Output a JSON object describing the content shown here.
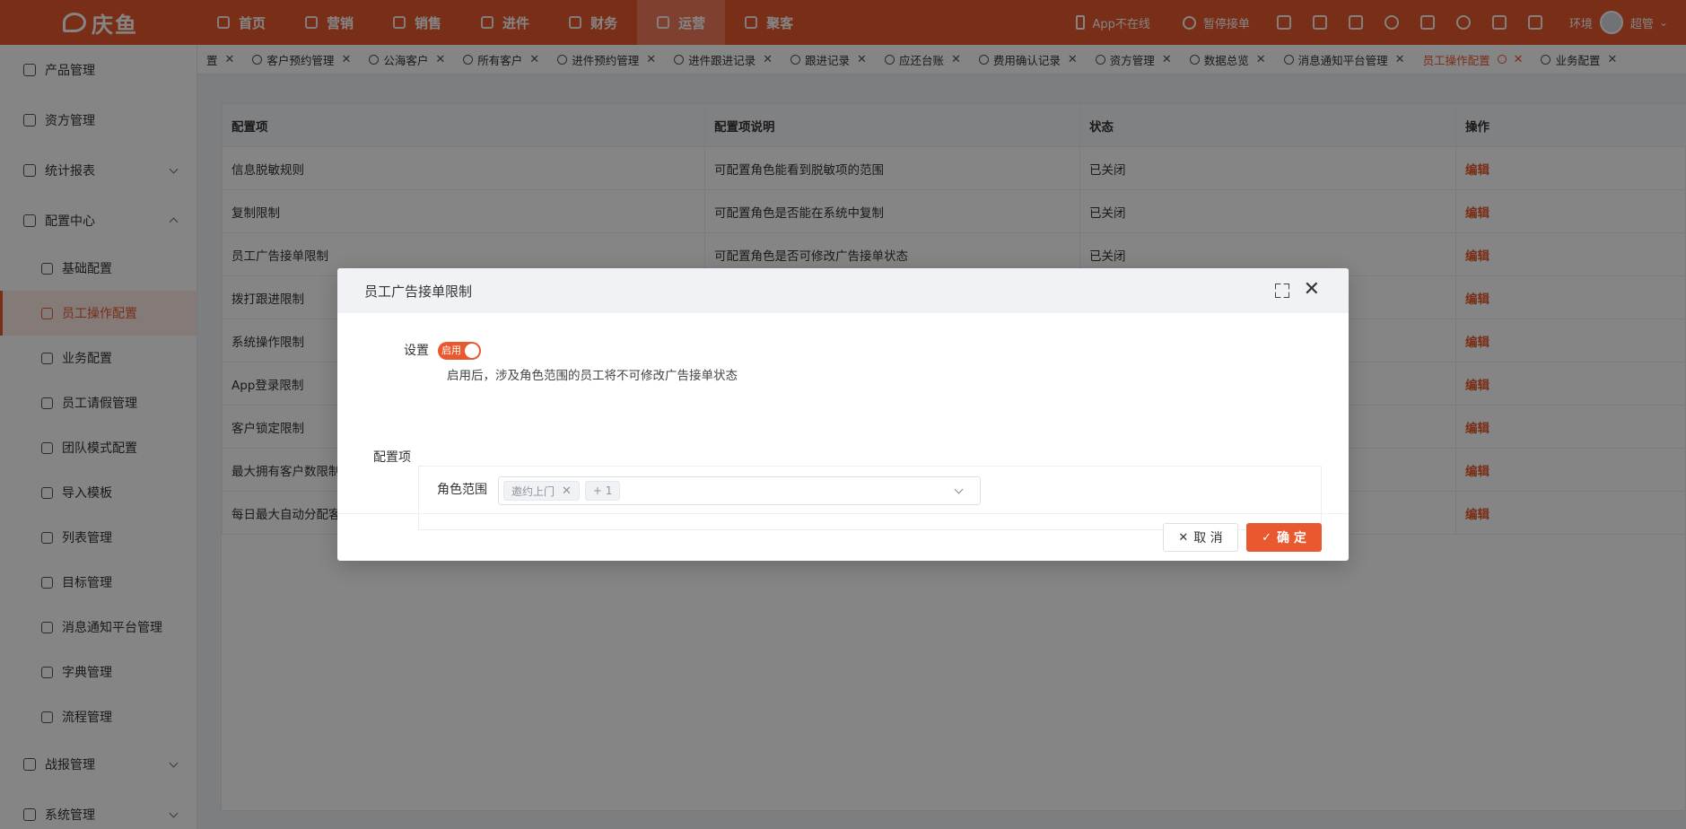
{
  "brand": {
    "name": "庆鱼"
  },
  "topnav": [
    {
      "label": "首页",
      "icon": "home-icon"
    },
    {
      "label": "营销",
      "icon": "shield-icon"
    },
    {
      "label": "销售",
      "icon": "user-icon"
    },
    {
      "label": "进件",
      "icon": "document-icon"
    },
    {
      "label": "财务",
      "icon": "finance-icon"
    },
    {
      "label": "运营",
      "icon": "chat-icon",
      "active": true
    },
    {
      "label": "聚客",
      "icon": "team-icon"
    }
  ],
  "topright": {
    "app_status": "App不在线",
    "pause_label": "暂停接单",
    "env_label": "环境",
    "user_name": "超管"
  },
  "sidebar": {
    "groups": [
      {
        "label": "产品管理",
        "icon": "layers-icon"
      },
      {
        "label": "资方管理",
        "icon": "fund-icon"
      },
      {
        "label": "统计报表",
        "icon": "chart-icon",
        "arrow": "down"
      },
      {
        "label": "配置中心",
        "icon": "gear-icon",
        "arrow": "up"
      }
    ],
    "sub_items": [
      {
        "label": "基础配置",
        "icon": "settings-icon"
      },
      {
        "label": "员工操作配置",
        "icon": "user-config-icon",
        "active": true
      },
      {
        "label": "业务配置",
        "icon": "briefcase-icon"
      },
      {
        "label": "员工请假管理",
        "icon": "leave-icon"
      },
      {
        "label": "团队模式配置",
        "icon": "team-mode-icon"
      },
      {
        "label": "导入模板",
        "icon": "import-icon"
      },
      {
        "label": "列表管理",
        "icon": "list-icon"
      },
      {
        "label": "目标管理",
        "icon": "target-icon"
      },
      {
        "label": "消息通知平台管理",
        "icon": "message-icon"
      },
      {
        "label": "字典管理",
        "icon": "dictionary-icon"
      },
      {
        "label": "流程管理",
        "icon": "flow-icon"
      }
    ],
    "bottom_groups": [
      {
        "label": "战报管理",
        "icon": "report-icon",
        "arrow": "down"
      },
      {
        "label": "系统管理",
        "icon": "system-icon",
        "arrow": "down"
      }
    ]
  },
  "tabs": [
    {
      "label": "置",
      "partial": true
    },
    {
      "label": "客户预约管理"
    },
    {
      "label": "公海客户"
    },
    {
      "label": "所有客户"
    },
    {
      "label": "进件预约管理"
    },
    {
      "label": "进件跟进记录"
    },
    {
      "label": "跟进记录"
    },
    {
      "label": "应还台账"
    },
    {
      "label": "费用确认记录"
    },
    {
      "label": "资方管理"
    },
    {
      "label": "数据总览"
    },
    {
      "label": "消息通知平台管理"
    },
    {
      "label": "员工操作配置",
      "active": true
    },
    {
      "label": "业务配置"
    }
  ],
  "table": {
    "headers": [
      "配置项",
      "配置项说明",
      "状态",
      "操作"
    ],
    "rows": [
      [
        "信息脱敏规则",
        "可配置角色能看到脱敏项的范围",
        "已关闭",
        "编辑"
      ],
      [
        "复制限制",
        "可配置角色是否能在系统中复制",
        "已关闭",
        "编辑"
      ],
      [
        "员工广告接单限制",
        "可配置角色是否可修改广告接单状态",
        "已关闭",
        "编辑"
      ],
      [
        "拨打跟进限制",
        "",
        "",
        "编辑"
      ],
      [
        "系统操作限制",
        "",
        "",
        "编辑"
      ],
      [
        "App登录限制",
        "",
        "",
        "编辑"
      ],
      [
        "客户锁定限制",
        "",
        "",
        "编辑"
      ],
      [
        "最大拥有客户数限制",
        "",
        "",
        "编辑"
      ],
      [
        "每日最大自动分配客",
        "",
        "",
        "编辑"
      ]
    ]
  },
  "modal": {
    "title": "员工广告接单限制",
    "setting_label": "设置",
    "toggle_label": "启用",
    "toggle_on": true,
    "hint": "启用后，涉及角色范围的员工将不可修改广告接单状态",
    "config_label": "配置项",
    "role_label": "角色范围",
    "chip": "邀约上门",
    "more_chip": "+ 1",
    "cancel_label": "取 消",
    "ok_label": "确 定"
  },
  "colors": {
    "accent": "#e9582e"
  }
}
